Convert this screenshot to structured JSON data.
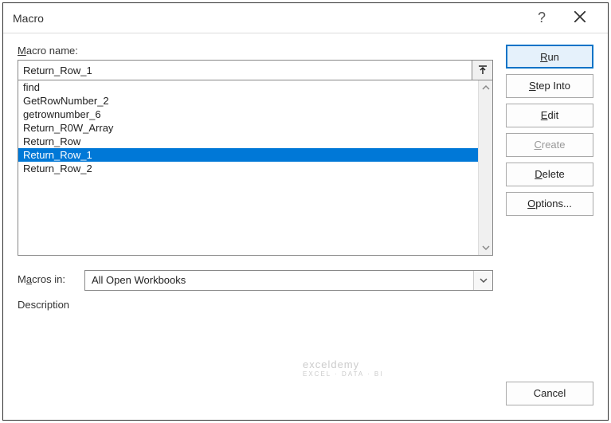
{
  "titlebar": {
    "title": "Macro",
    "help": "?",
    "close_label": "Close"
  },
  "labels": {
    "macro_name_prefix": "M",
    "macro_name_rest": "acro name:",
    "macros_in_prefix": "M",
    "macros_in_underline": "a",
    "macros_in_rest": "cros in:",
    "description": "Description"
  },
  "macro_name": {
    "value": "Return_Row_1"
  },
  "macro_list": {
    "items": [
      {
        "name": "find",
        "selected": false
      },
      {
        "name": "GetRowNumber_2",
        "selected": false
      },
      {
        "name": "getrownumber_6",
        "selected": false
      },
      {
        "name": "Return_R0W_Array",
        "selected": false
      },
      {
        "name": "Return_Row",
        "selected": false
      },
      {
        "name": "Return_Row_1",
        "selected": true
      },
      {
        "name": "Return_Row_2",
        "selected": false
      }
    ]
  },
  "macros_in": {
    "value": "All Open Workbooks"
  },
  "buttons": {
    "run_underline": "R",
    "run_rest": "un",
    "step_into_pre": "",
    "step_into_underline": "S",
    "step_into_rest": "tep Into",
    "edit_pre": "",
    "edit_underline": "E",
    "edit_rest": "dit",
    "create_pre": "",
    "create_underline": "C",
    "create_rest": "reate",
    "delete_pre": "",
    "delete_underline": "D",
    "delete_rest": "elete",
    "options_pre": "",
    "options_underline": "O",
    "options_rest": "ptions...",
    "cancel": "Cancel"
  },
  "watermark": {
    "main": "exceldemy",
    "sub": "EXCEL · DATA · BI"
  }
}
